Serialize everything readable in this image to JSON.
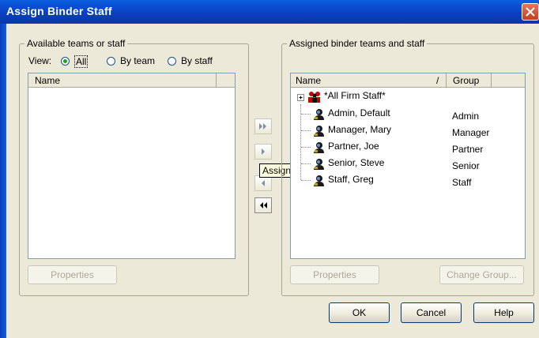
{
  "window": {
    "title": "Assign Binder Staff"
  },
  "available": {
    "group_label": "Available teams or staff",
    "view_label": "View:",
    "radios": [
      {
        "label": "All",
        "selected": true
      },
      {
        "label": "By team",
        "selected": false
      },
      {
        "label": "By staff",
        "selected": false
      }
    ],
    "column_name": "Name",
    "properties_button": "Properties"
  },
  "assigned": {
    "group_label": "Assigned binder teams and staff",
    "column_name": "Name",
    "sort_indicator": "/",
    "column_group": "Group",
    "group_row": {
      "name": "*All Firm Staff*"
    },
    "rows": [
      {
        "name": "Admin, Default",
        "group": "Admin"
      },
      {
        "name": "Manager, Mary",
        "group": "Manager"
      },
      {
        "name": "Partner, Joe",
        "group": "Partner"
      },
      {
        "name": "Senior, Steve",
        "group": "Senior"
      },
      {
        "name": "Staff, Greg",
        "group": "Staff"
      }
    ],
    "properties_button": "Properties",
    "change_group_button": "Change Group..."
  },
  "tooltip": "Assign",
  "footer": {
    "ok": "OK",
    "cancel": "Cancel",
    "help": "Help"
  },
  "colors": {
    "title_bar": "#0a3fbf",
    "dialog_bg": "#ece9d8",
    "close_button": "#c2401e"
  }
}
